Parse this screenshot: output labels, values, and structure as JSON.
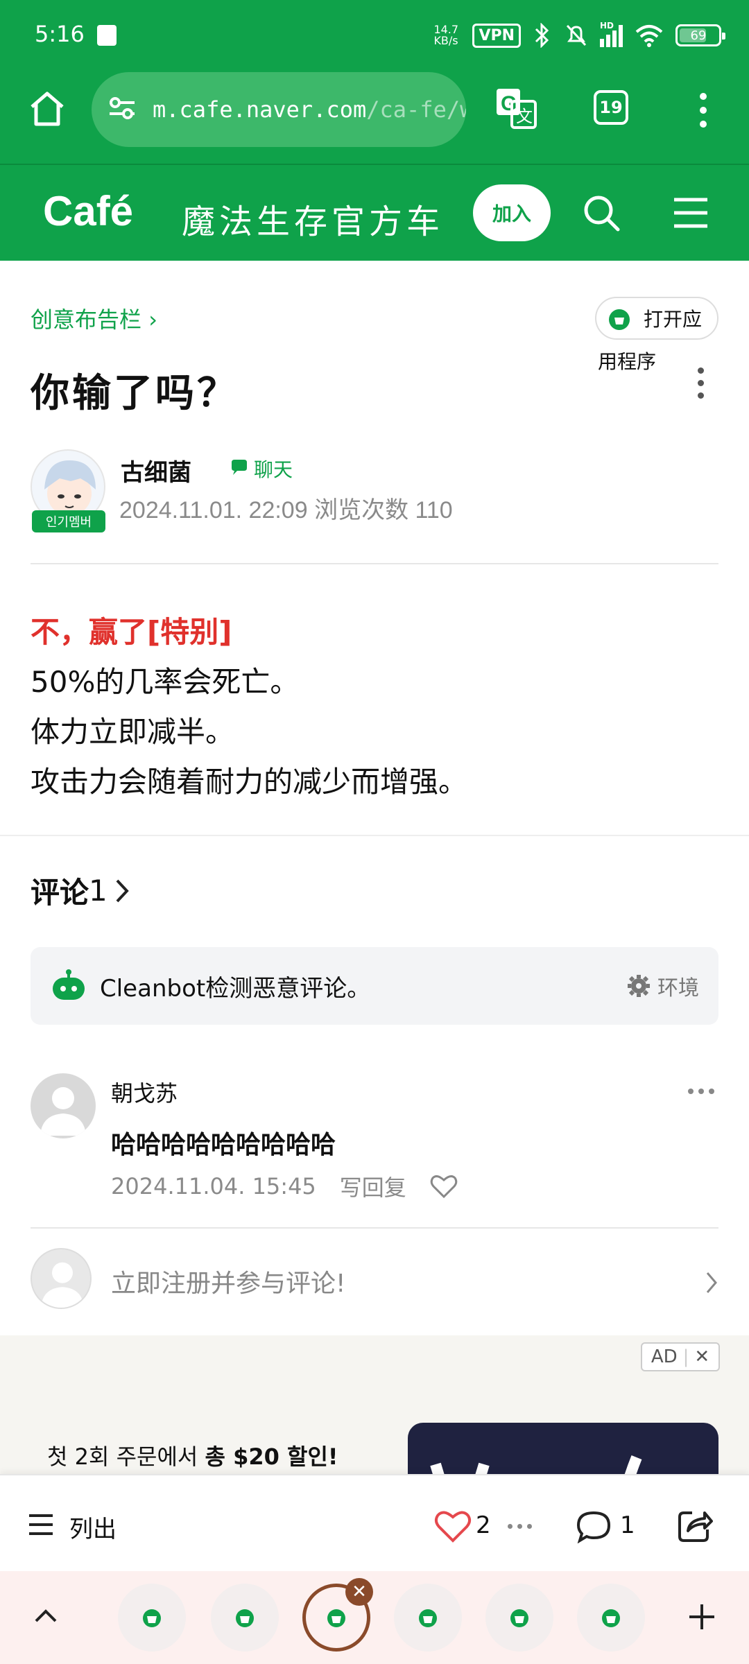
{
  "status": {
    "time": "5:16",
    "speed": "14.7\nKB/s",
    "vpn": "VPN",
    "network": "HD",
    "battery": "69"
  },
  "browser": {
    "url_host": "m.cafe.naver.com",
    "url_path": "/ca-fe/w",
    "tab_count": "19"
  },
  "cafe": {
    "brand": "Café",
    "name": "魔法生存官方车",
    "join_label": "加入"
  },
  "post": {
    "board": "创意布告栏",
    "open_app_line1": "打开应",
    "open_app_line2": "用程序",
    "title": "你输了吗？",
    "author": "古细菌",
    "rank": "인기멤버",
    "chat_label": "聊天",
    "meta": "2024.11.01. 22:09  浏览次数 110",
    "body_highlight": "不，赢了[特别]",
    "body_lines": [
      "50%的几率会死亡。",
      "体力立即减半。",
      "攻击力会随着耐力的减少而增强。"
    ]
  },
  "comments": {
    "heading": "评论",
    "count": "1",
    "cleanbot_text": "Cleanbot检测恶意评论。",
    "cleanbot_env": "环境",
    "items": [
      {
        "name": "朝戈苏",
        "text": "哈哈哈哈哈哈哈哈哈",
        "date": "2024.11.04. 15:45",
        "reply": "写回复"
      }
    ],
    "register_prompt": "立即注册并参与评论!"
  },
  "ad": {
    "tag": "AD",
    "text_prefix": "첫 2회 주문에서 ",
    "text_bold": "총 $20 할인!"
  },
  "bottom": {
    "list_label": "列出",
    "like_count": "2",
    "comment_count": "1"
  },
  "colors": {
    "brand_green": "#0fa24a",
    "highlight_red": "#e0312c",
    "like_red": "#e5484d"
  }
}
